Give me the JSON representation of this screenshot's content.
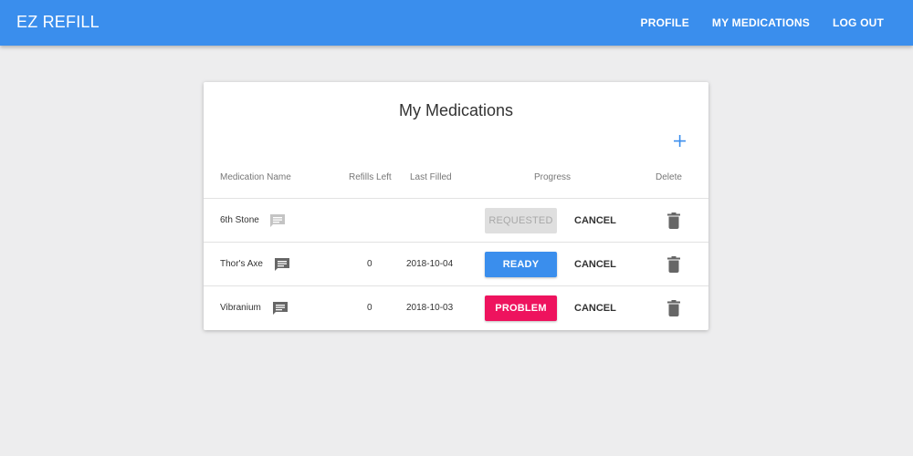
{
  "app": {
    "title": "EZ REFILL",
    "nav": [
      "PROFILE",
      "MY MEDICATIONS",
      "LOG OUT"
    ],
    "accent_color": "#3a8eed"
  },
  "card": {
    "title": "My Medications",
    "add_icon": "plus-icon",
    "headers": {
      "name": "Medication Name",
      "refills": "Refills Left",
      "last_filled": "Last Filled",
      "progress": "Progress",
      "delete": "Delete"
    },
    "rows": [
      {
        "name": "6th Stone",
        "refills": "",
        "last_filled": "",
        "status": "REQUESTED",
        "status_color": "#dfdfdf",
        "cancel": "CANCEL",
        "chat_icon_color": "#c4c4c4"
      },
      {
        "name": "Thor's Axe",
        "refills": "0",
        "last_filled": "2018-10-04",
        "status": "READY",
        "status_color": "#3a8eed",
        "cancel": "CANCEL",
        "chat_icon_color": "#666666"
      },
      {
        "name": "Vibranium",
        "refills": "0",
        "last_filled": "2018-10-03",
        "status": "PROBLEM",
        "status_color": "#ee135e",
        "cancel": "CANCEL",
        "chat_icon_color": "#666666"
      }
    ]
  }
}
